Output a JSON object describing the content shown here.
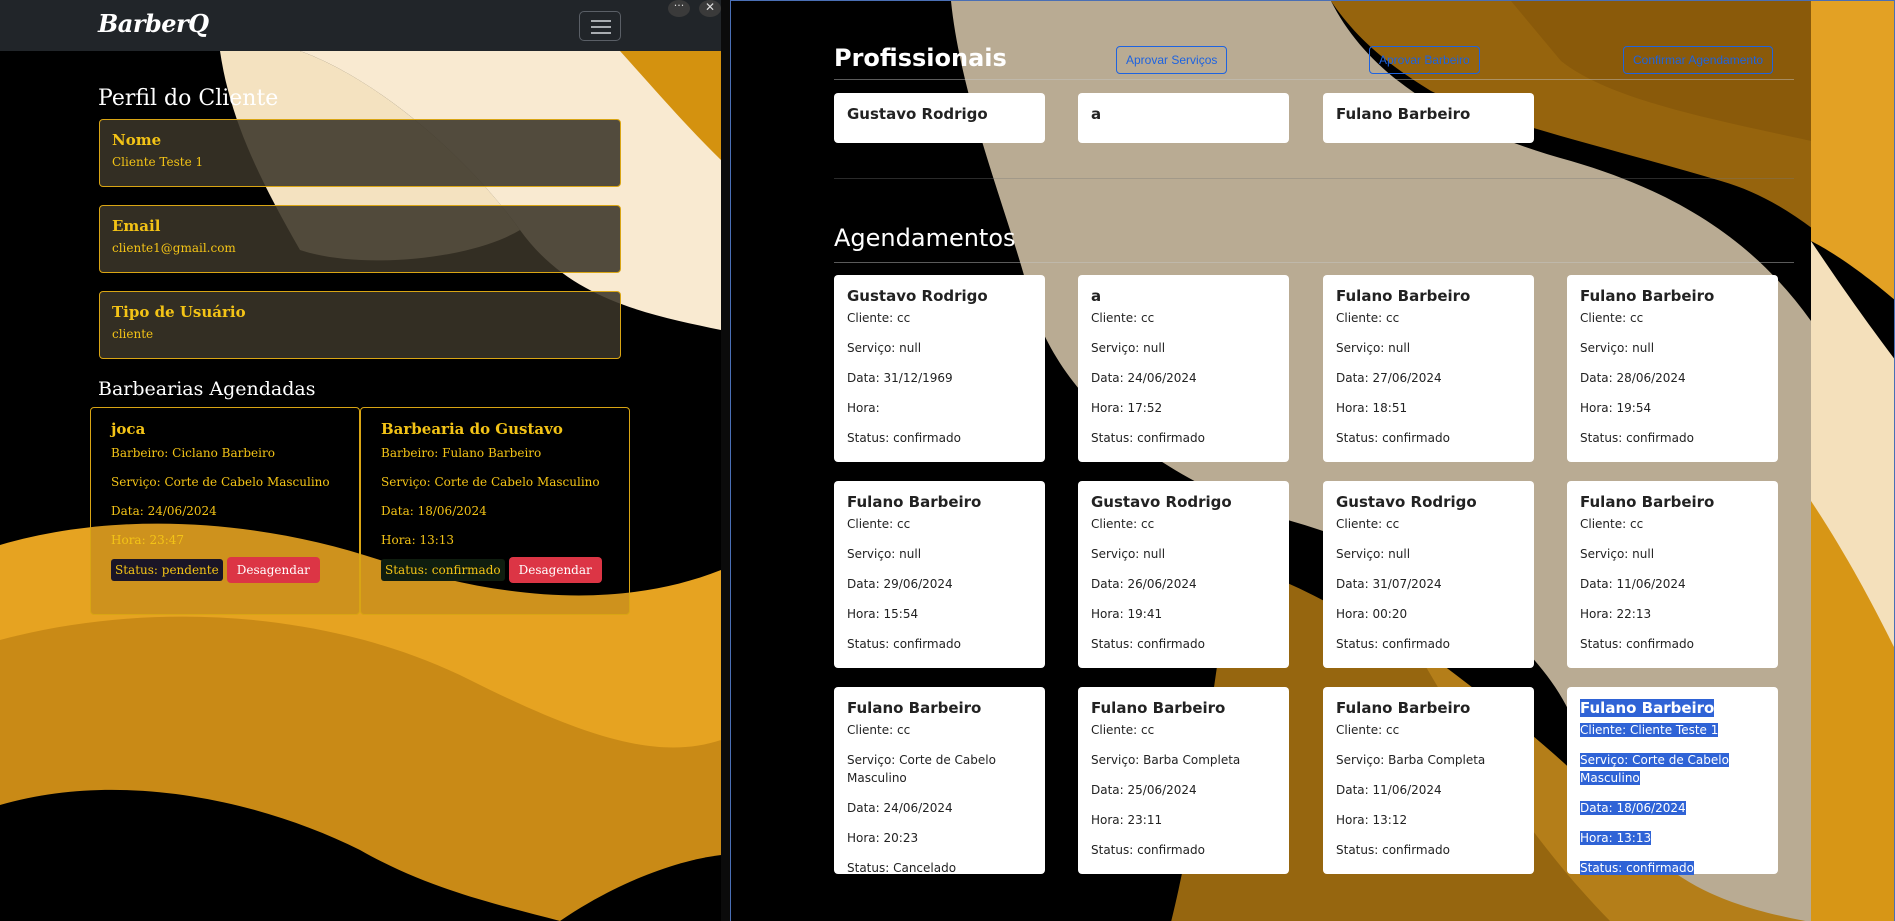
{
  "left": {
    "brand": "BarberQ",
    "profile_title": "Perfil do Cliente",
    "fields": [
      {
        "label": "Nome",
        "value": "Cliente Teste 1"
      },
      {
        "label": "Email",
        "value": "cliente1@gmail.com"
      },
      {
        "label": "Tipo de Usuário",
        "value": "cliente"
      }
    ],
    "bookings_title": "Barbearias Agendadas",
    "bookings": [
      {
        "name": "joca",
        "barbeiro": "Barbeiro: Ciclano Barbeiro",
        "servico": "Serviço: Corte de Cabelo Masculino",
        "data": "Data: 24/06/2024",
        "hora": "Hora: 23:47",
        "status": "Status: pendente",
        "button": "Desagendar"
      },
      {
        "name": "Barbearia do Gustavo",
        "barbeiro": "Barbeiro: Fulano Barbeiro",
        "servico": "Serviço: Corte de Cabelo Masculino",
        "data": "Data: 18/06/2024",
        "hora": "Hora: 13:13",
        "status": "Status: confirmado",
        "button": "Desagendar"
      }
    ]
  },
  "window_controls": {
    "more": "···",
    "close": "✕"
  },
  "right": {
    "profissionais_title": "Profissionais",
    "buttons": {
      "aprovar_servicos": "Aprovar Serviços",
      "aprovar_barbeiro": "Aprovar Barbeiro",
      "confirmar_agendamento": "Confirmar Agendamento"
    },
    "profissionais": [
      "Gustavo Rodrigo",
      "a",
      "Fulano Barbeiro"
    ],
    "agendamentos_title": "Agendamentos",
    "agendamentos": [
      {
        "nome": "Gustavo Rodrigo",
        "cliente": "Cliente: cc",
        "servico": "Serviço: null",
        "data": "Data: 31/12/1969",
        "hora": "Hora:",
        "status": "Status: confirmado"
      },
      {
        "nome": "a",
        "cliente": "Cliente: cc",
        "servico": "Serviço: null",
        "data": "Data: 24/06/2024",
        "hora": "Hora: 17:52",
        "status": "Status: confirmado"
      },
      {
        "nome": "Fulano Barbeiro",
        "cliente": "Cliente: cc",
        "servico": "Serviço: null",
        "data": "Data: 27/06/2024",
        "hora": "Hora: 18:51",
        "status": "Status: confirmado"
      },
      {
        "nome": "Fulano Barbeiro",
        "cliente": "Cliente: cc",
        "servico": "Serviço: null",
        "data": "Data: 28/06/2024",
        "hora": "Hora: 19:54",
        "status": "Status: confirmado"
      },
      {
        "nome": "Fulano Barbeiro",
        "cliente": "Cliente: cc",
        "servico": "Serviço: null",
        "data": "Data: 29/06/2024",
        "hora": "Hora: 15:54",
        "status": "Status: confirmado"
      },
      {
        "nome": "Gustavo Rodrigo",
        "cliente": "Cliente: cc",
        "servico": "Serviço: null",
        "data": "Data: 26/06/2024",
        "hora": "Hora: 19:41",
        "status": "Status: confirmado"
      },
      {
        "nome": "Gustavo Rodrigo",
        "cliente": "Cliente: cc",
        "servico": "Serviço: null",
        "data": "Data: 31/07/2024",
        "hora": "Hora: 00:20",
        "status": "Status: confirmado"
      },
      {
        "nome": "Fulano Barbeiro",
        "cliente": "Cliente: cc",
        "servico": "Serviço: null",
        "data": "Data: 11/06/2024",
        "hora": "Hora: 22:13",
        "status": "Status: confirmado"
      },
      {
        "nome": "Fulano Barbeiro",
        "cliente": "Cliente: cc",
        "servico": "Serviço: Corte de Cabelo Masculino",
        "data": "Data: 24/06/2024",
        "hora": "Hora: 20:23",
        "status": "Status: Cancelado"
      },
      {
        "nome": "Fulano Barbeiro",
        "cliente": "Cliente: cc",
        "servico": "Serviço: Barba Completa",
        "data": "Data: 25/06/2024",
        "hora": "Hora: 23:11",
        "status": "Status: confirmado"
      },
      {
        "nome": "Fulano Barbeiro",
        "cliente": "Cliente: cc",
        "servico": "Serviço: Barba Completa",
        "data": "Data: 11/06/2024",
        "hora": "Hora: 13:12",
        "status": "Status: confirmado"
      },
      {
        "nome": "Fulano Barbeiro",
        "cliente": "Cliente: Cliente Teste 1",
        "servico": "Serviço: Corte de Cabelo Masculino",
        "data": "Data: 18/06/2024",
        "hora": "Hora: 13:13",
        "status": "Status: confirmado"
      }
    ]
  },
  "colors": {
    "accent_gold": "#f3c316",
    "danger": "#dc3545",
    "primary": "#1e63e0",
    "selection": "#2f63d6"
  }
}
